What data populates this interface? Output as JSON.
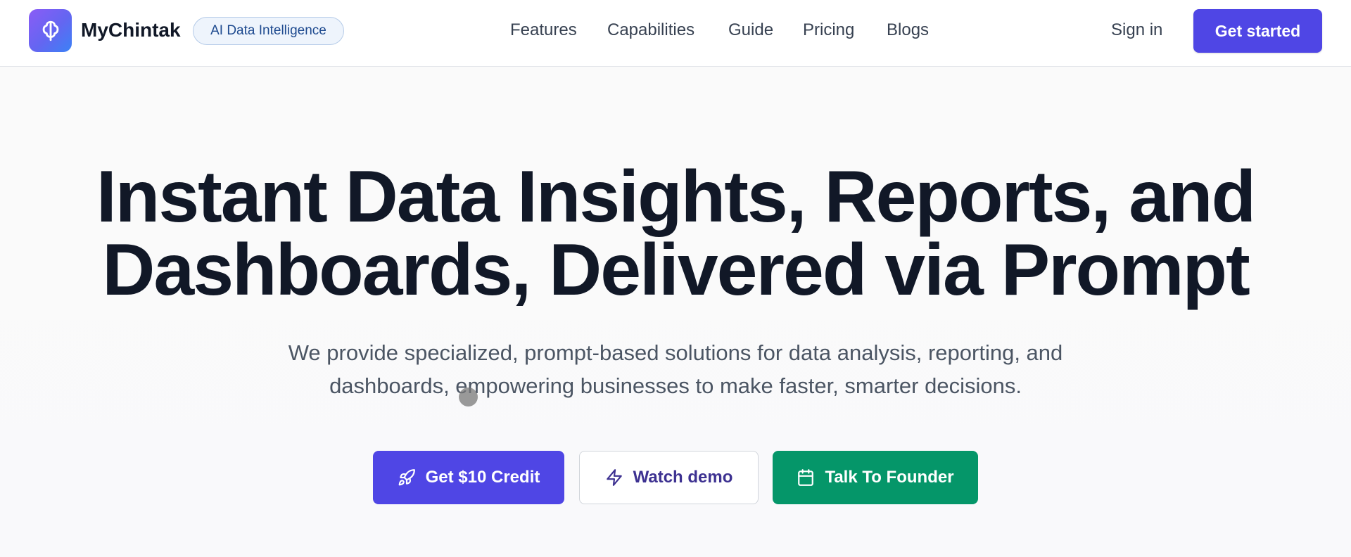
{
  "header": {
    "brand_name": "MyChintak",
    "badge": "AI Data Intelligence",
    "logo_icon": "brain-icon",
    "nav": [
      "Features",
      "Capabilities",
      "Guide",
      "Pricing",
      "Blogs"
    ],
    "sign_in": "Sign in",
    "get_started": "Get started"
  },
  "hero": {
    "title_line1": "Instant Data Insights, Reports, and",
    "title_line2": "Dashboards, Delivered via Prompt",
    "subtitle_line1": "We provide specialized, prompt-based solutions for data analysis, reporting, and",
    "subtitle_line2": "dashboards, empowering businesses to make faster, smarter decisions.",
    "buttons": {
      "credit": {
        "label": "Get $10 Credit",
        "icon": "rocket-icon"
      },
      "demo": {
        "label": "Watch demo",
        "icon": "lightning-icon"
      },
      "founder": {
        "label": "Talk To Founder",
        "icon": "calendar-icon"
      }
    }
  },
  "colors": {
    "primary": "#4f46e5",
    "success": "#059669",
    "heading": "#111827",
    "body_text": "#4b5563"
  }
}
